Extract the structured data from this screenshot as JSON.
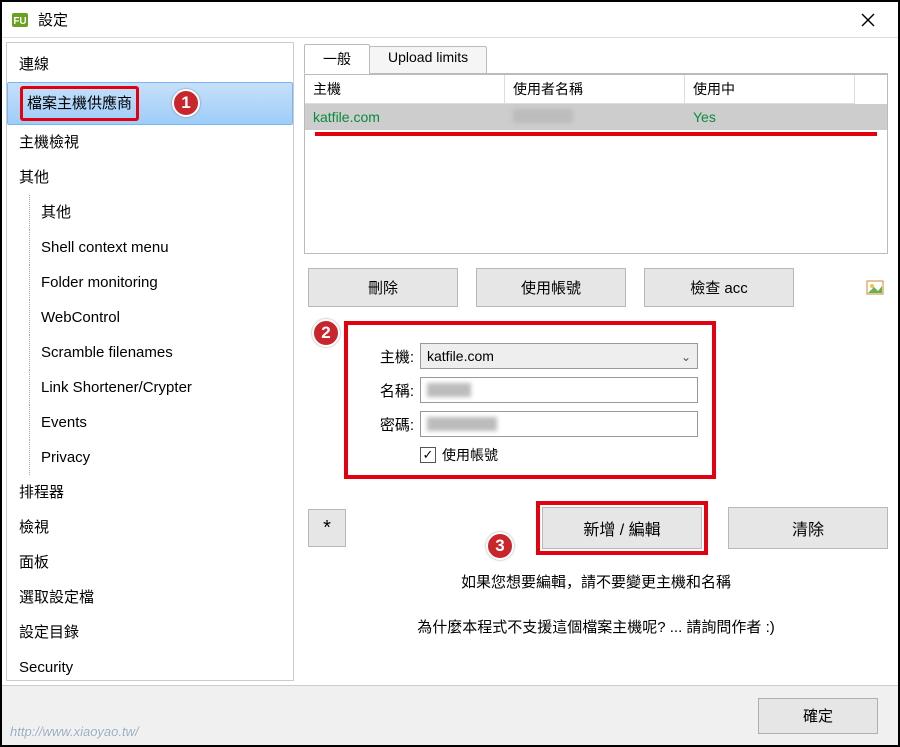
{
  "window": {
    "title": "設定",
    "close_aria": "Close"
  },
  "sidebar": {
    "items": [
      {
        "label": "連線",
        "level": 0
      },
      {
        "label": "檔案主機供應商",
        "level": 0,
        "selected": true,
        "boxed": true,
        "badge": "1"
      },
      {
        "label": "主機檢視",
        "level": 0
      },
      {
        "label": "其他",
        "level": 0
      },
      {
        "label": "其他",
        "level": 1
      },
      {
        "label": "Shell context menu",
        "level": 1
      },
      {
        "label": "Folder monitoring",
        "level": 1
      },
      {
        "label": "WebControl",
        "level": 1
      },
      {
        "label": "Scramble filenames",
        "level": 1
      },
      {
        "label": "Link Shortener/Crypter",
        "level": 1
      },
      {
        "label": "Events",
        "level": 1
      },
      {
        "label": "Privacy",
        "level": 1
      },
      {
        "label": "排程器",
        "level": 0
      },
      {
        "label": "檢視",
        "level": 0
      },
      {
        "label": "面板",
        "level": 0
      },
      {
        "label": "選取設定檔",
        "level": 0
      },
      {
        "label": "設定目錄",
        "level": 0
      },
      {
        "label": "Security",
        "level": 0
      }
    ]
  },
  "tabs": {
    "general": "一般",
    "upload_limits": "Upload limits"
  },
  "table": {
    "headers": {
      "host": "主機",
      "user": "使用者名稱",
      "active": "使用中"
    },
    "row": {
      "host": "katfile.com",
      "user": "",
      "active": "Yes"
    }
  },
  "buttons": {
    "delete": "刪除",
    "use_account": "使用帳號",
    "check_acc": "檢查 acc"
  },
  "form": {
    "badge": "2",
    "host_label": "主機:",
    "host_value": "katfile.com",
    "name_label": "名稱:",
    "pass_label": "密碼:",
    "use_account_label": "使用帳號",
    "use_account_checked": true
  },
  "actions": {
    "toggle": "*",
    "badge": "3",
    "add_edit": "新增 / 編輯",
    "clear": "清除"
  },
  "hint_edit": "如果您想要編輯，請不要變更主機和名稱",
  "hint_support": "為什麼本程式不支援這個檔案主機呢? ... 請詢問作者 :)",
  "footer": {
    "ok": "確定",
    "watermark": "http://www.xiaoyao.tw/"
  }
}
